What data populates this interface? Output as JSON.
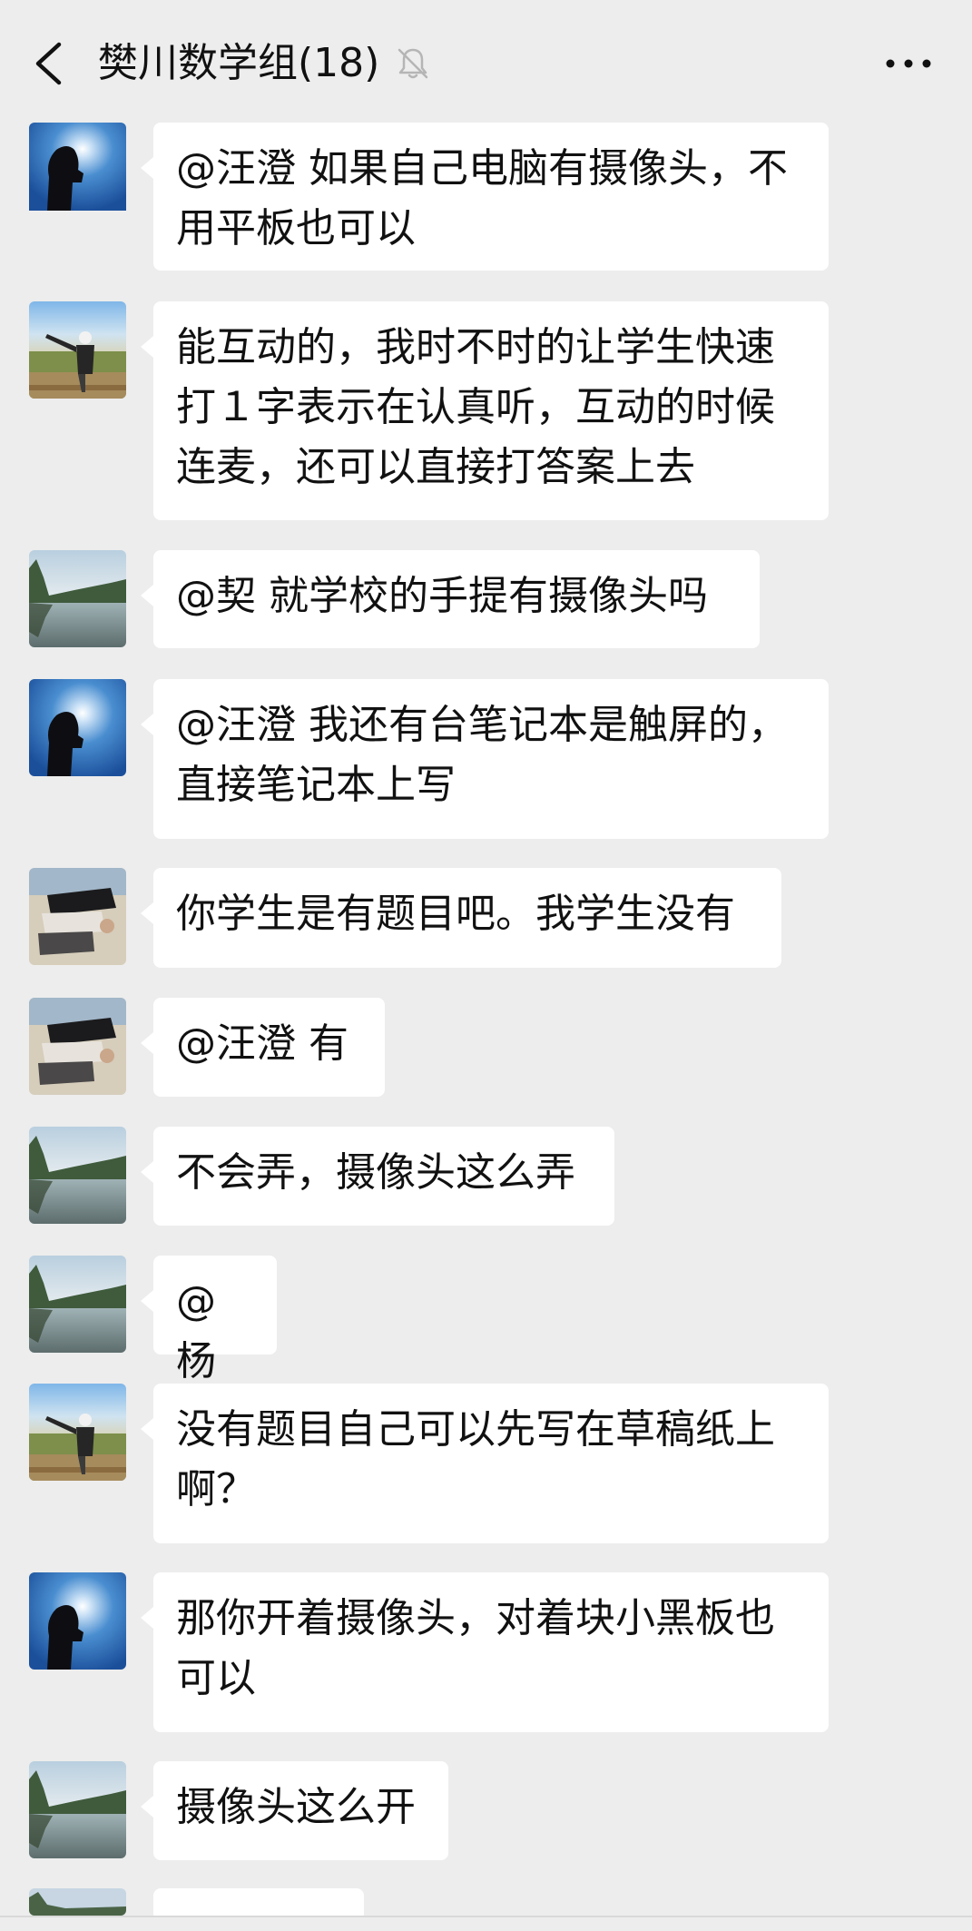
{
  "header": {
    "title": "樊川数学组(18)",
    "back_icon": "chevron-left-icon",
    "mute_icon": "bell-muted-icon",
    "more_icon": "more-horizontal-icon"
  },
  "messages": [
    {
      "text_lines": [
        "@汪澄  如果自己电脑有摄像头，不",
        "用平板也可以"
      ],
      "avatar": "avatar-sunlight"
    },
    {
      "text_lines": [
        "能互动的，我时不时的让学生快速",
        "打１字表示在认真听，互动的时候",
        "连麦，还可以直接打答案上去"
      ],
      "avatar": "avatar-field-man"
    },
    {
      "text_lines": [
        "@契  就学校的手提有摄像头吗"
      ],
      "avatar": "avatar-lake"
    },
    {
      "text_lines": [
        "@汪澄  我还有台笔记本是触屏的，",
        "直接笔记本上写"
      ],
      "avatar": "avatar-sunlight"
    },
    {
      "text_lines": [
        "你学生是有题目吧。我学生没有"
      ],
      "avatar": "avatar-rotated-person"
    },
    {
      "text_lines": [
        "@汪澄  有"
      ],
      "avatar": "avatar-rotated-person"
    },
    {
      "text_lines": [
        "不会弄，摄像头这么弄"
      ],
      "avatar": "avatar-lake"
    },
    {
      "text_lines": [
        "@杨"
      ],
      "avatar": "avatar-lake"
    },
    {
      "text_lines": [
        "没有题目自己可以先写在草稿纸上",
        "啊？"
      ],
      "avatar": "avatar-field-man"
    },
    {
      "text_lines": [
        "那你开着摄像头，对着块小黑板也",
        "可以"
      ],
      "avatar": "avatar-sunlight"
    },
    {
      "text_lines": [
        "摄像头这么开"
      ],
      "avatar": "avatar-lake"
    }
  ],
  "colors": {
    "background": "#ededed",
    "bubble": "#ffffff",
    "text": "#111111"
  }
}
